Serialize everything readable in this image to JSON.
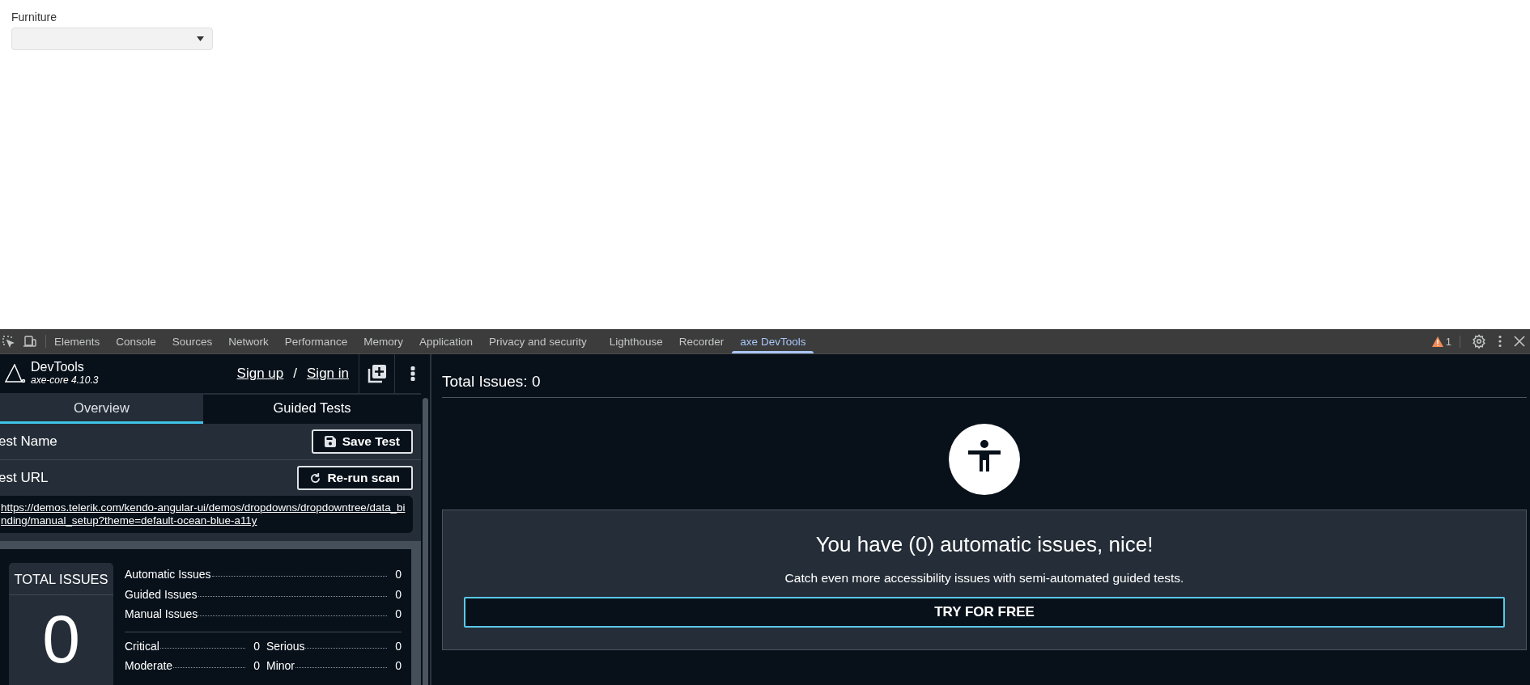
{
  "page": {
    "field_label": "Furniture"
  },
  "devtools": {
    "tabs": [
      {
        "label": "Elements",
        "selected": false
      },
      {
        "label": "Console",
        "selected": false
      },
      {
        "label": "Sources",
        "selected": false
      },
      {
        "label": "Network",
        "selected": false
      },
      {
        "label": "Performance",
        "selected": false
      },
      {
        "label": "Memory",
        "selected": false
      },
      {
        "label": "Application",
        "selected": false
      },
      {
        "label": "Privacy and security",
        "selected": false
      },
      {
        "label": "Lighthouse",
        "selected": false
      },
      {
        "label": "Recorder",
        "selected": false
      },
      {
        "label": "axe DevTools",
        "selected": true
      }
    ],
    "warning_count": "1"
  },
  "axe": {
    "brand": "DevTools",
    "engine_link": "axe-core",
    "engine_version": "4.10.3",
    "sign_up": "Sign up",
    "separator": "/",
    "sign_in": "Sign in",
    "tabs": [
      {
        "label": "Overview",
        "selected": true
      },
      {
        "label": "Guided Tests",
        "selected": false
      }
    ],
    "test_name_label": "est Name",
    "save_button": "Save Test",
    "test_url_label": "est URL",
    "rerun_button": "Re-run scan",
    "test_url": "https://demos.telerik.com/kendo-angular-ui/demos/dropdowns/dropdowntree/data_binding/manual_setup?theme=default-ocean-blue-a11y",
    "summary": {
      "title": "TOTAL ISSUES",
      "total": "0",
      "types": [
        {
          "label": "Automatic Issues",
          "value": "0"
        },
        {
          "label": "Guided Issues",
          "value": "0"
        },
        {
          "label": "Manual Issues",
          "value": "0"
        }
      ],
      "severities": [
        {
          "label": "Critical",
          "value": "0"
        },
        {
          "label": "Serious",
          "value": "0"
        },
        {
          "label": "Moderate",
          "value": "0"
        },
        {
          "label": "Minor",
          "value": "0"
        }
      ]
    }
  },
  "results": {
    "heading": "Total Issues: 0",
    "message": "You have (0) automatic issues, nice!",
    "subtext": "Catch even more accessibility issues with semi-automated guided tests.",
    "cta_button": "TRY FOR FREE"
  }
}
